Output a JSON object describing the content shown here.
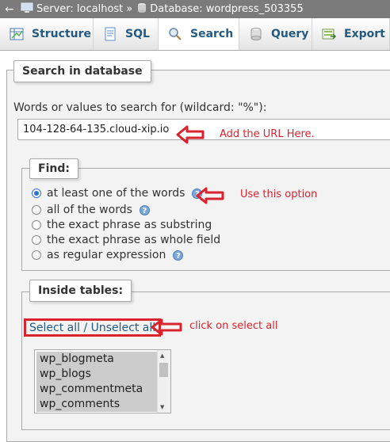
{
  "breadcrumb": {
    "back": "←",
    "server": "Server: localhost",
    "separator": "»",
    "database": "Database: wordpress_503355"
  },
  "tabs": [
    {
      "label": "Structure",
      "icon": "structure-icon"
    },
    {
      "label": "SQL",
      "icon": "sql-icon"
    },
    {
      "label": "Search",
      "icon": "search-icon",
      "active": true
    },
    {
      "label": "Query",
      "icon": "query-icon"
    },
    {
      "label": "Export",
      "icon": "export-icon"
    }
  ],
  "search": {
    "legend": "Search in database",
    "label": "Words or values to search for (wildcard: \"%\"):",
    "value": "104-128-64-135.cloud-xip.io"
  },
  "find": {
    "legend": "Find:",
    "options": [
      {
        "label": "at least one of the words",
        "checked": true,
        "help": true
      },
      {
        "label": "all of the words",
        "checked": false,
        "help": true
      },
      {
        "label": "the exact phrase as substring",
        "checked": false,
        "help": false
      },
      {
        "label": "the exact phrase as whole field",
        "checked": false,
        "help": false
      },
      {
        "label": "as regular expression",
        "checked": false,
        "help": true
      }
    ]
  },
  "tables": {
    "legend": "Inside tables:",
    "select_all": "Select all / Unselect all",
    "items": [
      "wp_blogmeta",
      "wp_blogs",
      "wp_commentmeta",
      "wp_comments"
    ]
  },
  "annotations": {
    "url": "Add the URL Here.",
    "option": "Use this option",
    "select_all": "click on select all"
  },
  "colors": {
    "annotation": "#d9232e",
    "link": "#235a81",
    "radio_accent": "#2a72d6"
  }
}
